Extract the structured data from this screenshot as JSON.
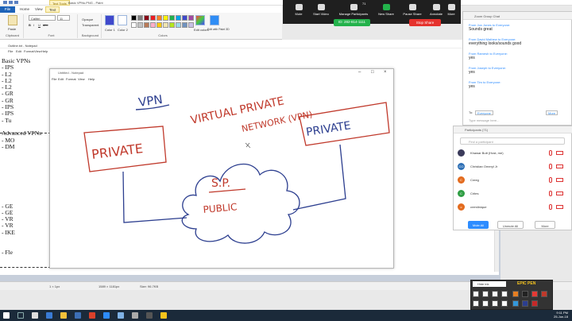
{
  "paint": {
    "context_tab": "Text Tools",
    "window_title": "Basic VPNs.PNG - Paint",
    "tabs": [
      "File",
      "Home",
      "View",
      "Text"
    ],
    "clipboard": {
      "paste": "Paste",
      "label": "Clipboard"
    },
    "font": {
      "name": "Calibri",
      "size": "11",
      "label": "Font"
    },
    "background": {
      "opaque": "Opaque",
      "transparent": "Transparent",
      "label": "Background"
    },
    "colors": {
      "color1": "Color 1",
      "color2": "Color 2",
      "edit": "Edit colors",
      "edit_paint3d": "Edit with Paint 3D",
      "label": "Colors"
    },
    "palette": [
      "#000000",
      "#7f7f7f",
      "#880015",
      "#ed1c24",
      "#ff7f27",
      "#fff200",
      "#22b14c",
      "#00a2e8",
      "#3f48cc",
      "#a349a4",
      "#ffffff",
      "#c3c3c3",
      "#b97a57",
      "#ffaec9",
      "#ffc90e",
      "#efe4b0",
      "#b5e61d",
      "#99d9ea",
      "#7092be",
      "#c8bfe7"
    ]
  },
  "notepad": {
    "title": "Outline.txt - Notepad",
    "menu": [
      "File",
      "Edit",
      "Format",
      "View",
      "Help"
    ],
    "lines": [
      "Basic VPNs",
      "- IPS",
      "- L2",
      "- L2",
      "- L2",
      "- GR",
      "- GR",
      "- IPS",
      "- IPS",
      "- Tu",
      "",
      "Advanced VPNs",
      "- MO",
      "- DM",
      "",
      "",
      "",
      "",
      "",
      "",
      "",
      "",
      "- GE",
      "- GE",
      "- VR",
      "- VR",
      "- IKE",
      "",
      "",
      "- Fle"
    ]
  },
  "untitled": {
    "title": "Untitled - Notepad",
    "menu": [
      "File",
      "Edit",
      "Format",
      "View",
      "Help"
    ]
  },
  "drawing": {
    "vpn": "VPN",
    "heading1": "VIRTUAL PRIVATE",
    "heading2": "NETWORK (VPN)",
    "left_box": "PRIVATE",
    "right_box": "PRIVATE",
    "cloud_top": "S.P.",
    "cloud_bottom": "PUBLIC"
  },
  "zoom": {
    "buttons": [
      "Mute",
      "Start Video",
      "Manage Participants",
      "New Share",
      "Pause Share",
      "Annotate",
      "More"
    ],
    "participant_count": "71",
    "meeting_id": "ID: 282-814-1111",
    "stop_share": "Stop Share"
  },
  "chat": {
    "title": "Zoom Group Chat",
    "messages": [
      {
        "from": "From Jon Jones to Everyone:",
        "text": "Sounds great"
      },
      {
        "from": "From David Mathew to Everyone:",
        "text": "everything looks/sounds good"
      },
      {
        "from": "From Ramesh to Everyone:",
        "text": "yes"
      },
      {
        "from": "From Joseph to Everyone:",
        "text": "yes"
      },
      {
        "from": "From Tim to Everyone:",
        "text": "yes"
      }
    ],
    "to_label": "To:",
    "recipient": "Everyone",
    "more": "More",
    "placeholder": "Type message here..."
  },
  "participants": {
    "title": "Participants (71)",
    "search_placeholder": "Find a participant",
    "rows": [
      {
        "name": "Khawar Butt (Host, me)",
        "initials": "",
        "color": "#3a3a5a"
      },
      {
        "name": "Christian Omeryl Jr",
        "initials": "CO",
        "color": "#2d6fb5"
      },
      {
        "name": "Creeg",
        "initials": "C",
        "color": "#e36b1e"
      },
      {
        "name": "Crites",
        "initials": "C",
        "color": "#2f9e44"
      },
      {
        "name": "cremlinique",
        "initials": "c",
        "color": "#e36b1e"
      }
    ],
    "mute_all": "Mute All",
    "unmute_all": "Unmute All",
    "more": "More"
  },
  "statusbar": {
    "selection": "1 × 1px",
    "dimensions": "1589 × 1181px",
    "size": "Size: 96.7KB"
  },
  "epic_pen": {
    "title": "EPIC PEN",
    "hide_ink": "Hide ink"
  },
  "clock": {
    "time": "9:11 PM",
    "date": "25-Jun-18"
  },
  "colors": {
    "zoom_green": "#23b24b",
    "zoom_red": "#e5322d",
    "zoom_blue": "#2d8cff",
    "ink_red": "#c0392b",
    "ink_blue": "#2c3e8f"
  }
}
